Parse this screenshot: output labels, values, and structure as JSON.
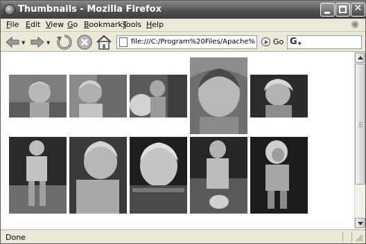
{
  "window": {
    "title": "Thumbnails - Mozilla Firefox"
  },
  "menu": [
    {
      "pre": "",
      "key": "F",
      "post": "ile"
    },
    {
      "pre": "",
      "key": "E",
      "post": "dit"
    },
    {
      "pre": "",
      "key": "V",
      "post": "iew"
    },
    {
      "pre": "",
      "key": "G",
      "post": "o"
    },
    {
      "pre": "",
      "key": "B",
      "post": "ookmarks"
    },
    {
      "pre": "",
      "key": "T",
      "post": "ools"
    },
    {
      "pre": "",
      "key": "H",
      "post": "elp"
    }
  ],
  "toolbar": {
    "url": "file:///C:/Program%20Files/Apache%20C",
    "go_label": "Go",
    "icons": [
      "back-arrow-icon",
      "forward-arrow-icon",
      "reload-icon",
      "stop-icon",
      "home-icon",
      "page-icon",
      "go-icon",
      "search-engine-icon"
    ]
  },
  "status": {
    "text": "Done"
  },
  "thumbnails": {
    "row1": [
      "photo-1",
      "photo-2",
      "photo-3",
      "photo-4",
      "photo-5"
    ],
    "row2": [
      "photo-6",
      "photo-7",
      "photo-8",
      "photo-9",
      "photo-10"
    ]
  },
  "colors": {
    "titlebar": "#4e4e4e",
    "chrome": "#ece9d8",
    "content": "#ffffff"
  }
}
